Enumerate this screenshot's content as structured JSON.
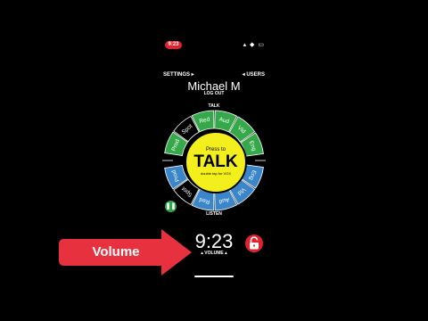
{
  "status_bar": {
    "time": "9:23",
    "icons": "▴ ◆ ▭"
  },
  "nav": {
    "settings": "SETTINGS ▸",
    "users": "◂ USERS"
  },
  "user": {
    "name": "Michael M",
    "logout": "LOG OUT"
  },
  "wheel": {
    "talk_label": "TALK",
    "listen_label": "LISTEN",
    "talk_segments": [
      "Prod",
      "Spot",
      "Red",
      "Aud",
      "Vid",
      "Eng"
    ],
    "listen_segments": [
      "Prod",
      "Spot",
      "Red",
      "Aud",
      "Vid",
      "Eng"
    ],
    "talk_segment_colors": [
      "#35a84a",
      "#ffffff",
      "#35a84a",
      "#35a84a",
      "#35a84a",
      "#35a84a"
    ],
    "listen_segment_colors": [
      "#3a86c8",
      "#ffffff",
      "#3a86c8",
      "#3a86c8",
      "#3a86c8",
      "#3a86c8"
    ]
  },
  "talk_button": {
    "top": "Press to",
    "main": "TALK",
    "sub": "double tap for VOX"
  },
  "controls": {
    "pause_icon": "pause-icon",
    "pause_glyph": "❚❚",
    "lock_icon": "unlock-icon"
  },
  "clock": {
    "time": "9:23",
    "volume_label": "▴ VOLUME ▴"
  },
  "annotation": {
    "label": "Volume",
    "color": "#e8313f"
  }
}
